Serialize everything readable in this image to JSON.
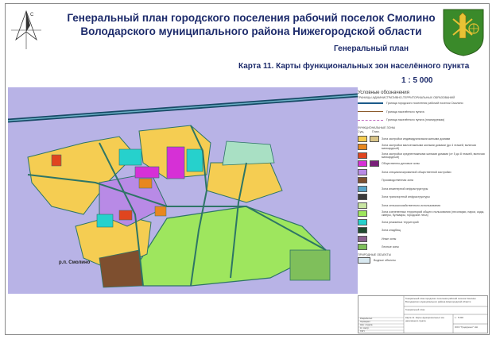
{
  "title": {
    "line1": "Генеральный план городского поселения рабочий поселок Смолино",
    "line2": "Володарского муниципального района Нижегородской области"
  },
  "subtitle": "Генеральный план",
  "map_title": "Карта 11.  Карты функциональных зон населённого пункта",
  "scale": "1 : 5 000",
  "compass_letter": "С",
  "town_label": "р.п. Смолино",
  "colors": {
    "residential_individual": "#f5cd52",
    "residential_lowrise": "#e8871e",
    "residential_midrise": "#e0451f",
    "public_business": "#d630d6",
    "social": "#b88ae6",
    "industrial": "#7e4f2f",
    "communal": "#8b5f8f",
    "transport": "#3a3a3a",
    "engineering": "#57a3c7",
    "green_common": "#9ee65e",
    "agricultural": "#c9e6a3",
    "cemetery": "#1f4a2f",
    "forest": "#7fbf5b",
    "special": "#26d1cc",
    "water": "#d8e8f0",
    "background": "#b8b3e6",
    "road": "#2e7566",
    "railway": "#174a66"
  },
  "legend": {
    "header": "Условные обозначения",
    "section_borders": "ГРАНИЦЫ АДМИНИСТРАТИВНО-ТЕРРИТОРИАЛЬНЫХ ОБРАЗОВАНИЙ",
    "borders": [
      {
        "label": "Граница городского поселения рабочий поселок Смолино",
        "color": "#1b5a8a"
      },
      {
        "label": "Граница населённого пункта",
        "color": "#8b5a2b"
      },
      {
        "label": "Граница населённого пункта (планируемая)",
        "color": "#c06ac0"
      }
    ],
    "section_zones": "ФУНКЦИОНАЛЬНЫЕ ЗОНЫ",
    "col_existing": "Сущ.",
    "col_planned": "План.",
    "zones": [
      {
        "label": "Зона застройки индивидуальными жилыми домами",
        "color": "#f5cd52",
        "color2": "#d9c488"
      },
      {
        "label": "Зона застройки малоэтажными жилыми домами (до 4 этажей, включая мансардный)",
        "color": "#e8871e",
        "color2": ""
      },
      {
        "label": "Зона застройки среднеэтажными жилыми домами (от 5 до 8 этажей, включая мансардный)",
        "color": "#e0451f",
        "color2": ""
      },
      {
        "label": "Общественно-деловые зоны",
        "color": "#d630d6",
        "color2": "#7a1f7a"
      },
      {
        "label": "Зона специализированной общественной застройки",
        "color": "#b88ae6",
        "color2": ""
      },
      {
        "label": "Производственная зона",
        "color": "#7e4f2f",
        "color2": ""
      },
      {
        "label": "Зона инженерной инфраструктуры",
        "color": "#57a3c7",
        "color2": ""
      },
      {
        "label": "Зона транспортной инфраструктуры",
        "color": "#3a3a3a",
        "color2": ""
      },
      {
        "label": "Зона сельскохозяйственного использования",
        "color": "#c9e6a3",
        "color2": ""
      },
      {
        "label": "Зона озелененных территорий общего пользования (лесопарки, парки, сады, скверы, бульвары, городские леса)",
        "color": "#9ee65e",
        "color2": ""
      },
      {
        "label": "Зона режимных территорий",
        "color": "#26d1cc",
        "color2": ""
      },
      {
        "label": "Зона кладбищ",
        "color": "#1f4a2f",
        "color2": ""
      },
      {
        "label": "Иные зоны",
        "color": "#8b5f8f",
        "color2": ""
      },
      {
        "label": "Лесные зоны",
        "color": "#7fbf5b",
        "color2": ""
      }
    ],
    "section_natural": "ПРИРОДНЫЕ ОБЪЕКТЫ",
    "natural": [
      {
        "label": "Водные объекты",
        "color": "#d8e8f0"
      }
    ]
  },
  "stamp": {
    "row1": "Генеральный план городского поселения рабочий поселок Смолино Володарского муниципального района Нижегородской области",
    "row2": "Генеральный план",
    "row3": "Карта 11. Карты функциональных зон населённого пункта",
    "scale": "1 : 5 000",
    "org": "ООО \"Градпроект\" НН",
    "people": [
      "Разработал",
      "Проверил",
      "Нач. отдела",
      "Н. контр.",
      "ГИП"
    ]
  }
}
